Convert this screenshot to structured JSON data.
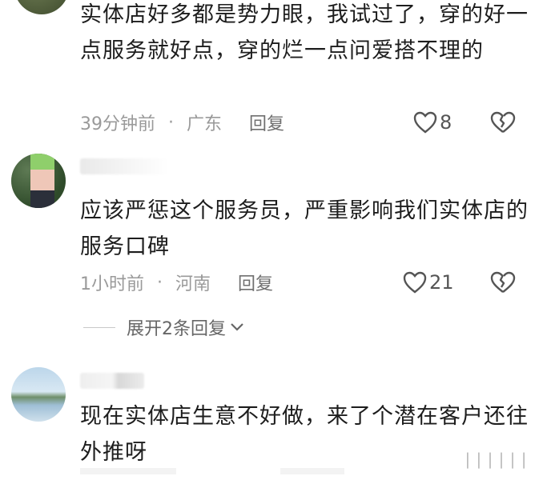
{
  "comments": [
    {
      "text": "实体店好多都是势力眼，我试过了，穿的好一点服务就好点，穿的烂一点问爱搭不理的",
      "time": "39分钟前",
      "location": "广东",
      "separator": "·",
      "reply_label": "回复",
      "likes": "8"
    },
    {
      "text": "应该严惩这个服务员，严重影响我们实体店的服务口碑",
      "time": "1小时前",
      "location": "河南",
      "separator": "·",
      "reply_label": "回复",
      "likes": "21",
      "expand_label": "展开2条回复"
    },
    {
      "text": "现在实体店生意不好做，来了个潜在客户还往外推呀"
    }
  ],
  "icons": {
    "like": "heart-outline-icon",
    "dislike": "broken-heart-icon",
    "expand": "chevron-down-icon"
  },
  "colors": {
    "text": "#1d1d1d",
    "meta": "#9a9a9a",
    "icon": "#555555"
  },
  "watermark": "∣∣∣∣∣∣"
}
